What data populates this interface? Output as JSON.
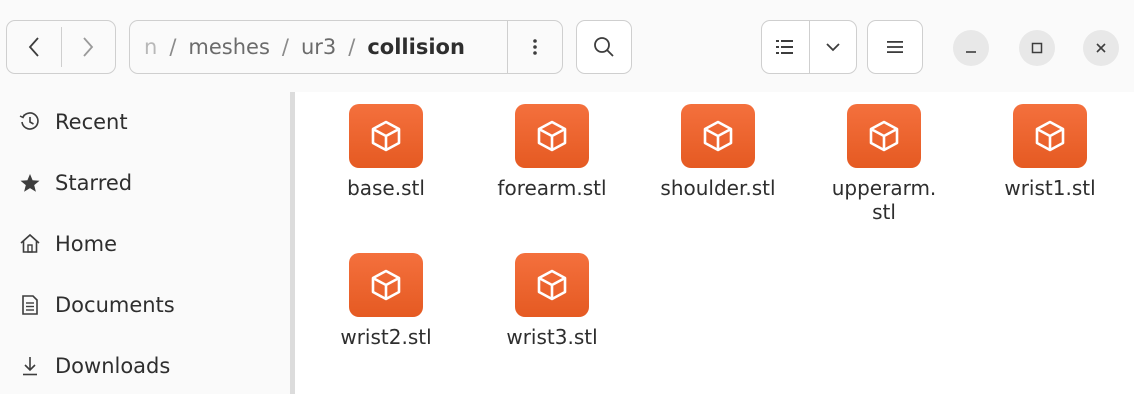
{
  "header": {
    "path": [
      "n",
      "meshes",
      "ur3",
      "collision"
    ],
    "path_separator": "/",
    "path_menu_icon": "vertical-ellipsis-icon",
    "icons": {
      "back": "chevron-left-icon",
      "forward": "chevron-right-icon",
      "search": "search-icon",
      "view": "list-view-icon",
      "view_options": "chevron-down-icon",
      "menu": "hamburger-icon",
      "minimize": "minimize-icon",
      "maximize": "maximize-icon",
      "close": "close-icon"
    }
  },
  "sidebar": {
    "items": [
      {
        "label": "Recent",
        "icon": "clock-icon"
      },
      {
        "label": "Starred",
        "icon": "star-icon"
      },
      {
        "label": "Home",
        "icon": "home-icon"
      },
      {
        "label": "Documents",
        "icon": "document-icon"
      },
      {
        "label": "Downloads",
        "icon": "download-icon"
      }
    ]
  },
  "files": [
    {
      "name": "base.stl",
      "icon": "3d-model-icon"
    },
    {
      "name": "forearm.stl",
      "icon": "3d-model-icon"
    },
    {
      "name": "shoulder.stl",
      "icon": "3d-model-icon"
    },
    {
      "name": "upperarm.\nstl",
      "icon": "3d-model-icon"
    },
    {
      "name": "wrist1.stl",
      "icon": "3d-model-icon"
    },
    {
      "name": "wrist2.stl",
      "icon": "3d-model-icon"
    },
    {
      "name": "wrist3.stl",
      "icon": "3d-model-icon"
    }
  ],
  "colors": {
    "file_icon": "#e95420",
    "accent": "#e95420"
  }
}
